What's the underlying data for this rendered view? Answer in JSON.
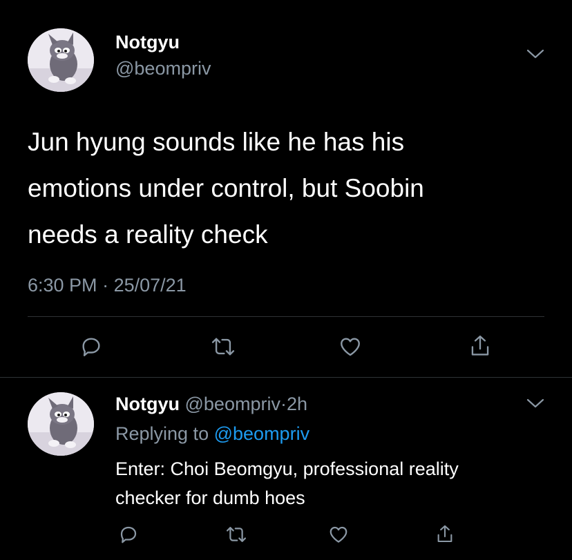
{
  "main_tweet": {
    "display_name": "Notgyu",
    "handle": "@beompriv",
    "text_lines": [
      "Jun hyung sounds like he has his",
      "emotions under control, but Soobin",
      "needs a reality check"
    ],
    "time": "6:30 PM",
    "separator": "·",
    "date": "25/07/21",
    "icons": [
      "reply-icon",
      "retweet-icon",
      "like-icon",
      "share-icon"
    ]
  },
  "reply_tweet": {
    "display_name": "Notgyu",
    "handle": "@beompriv",
    "separator": "·",
    "age": "2h",
    "replying_prefix": "Replying to",
    "replying_handle": "@beompriv",
    "text_lines": [
      "Enter: Choi Beomgyu, professional reality",
      "checker for dumb hoes"
    ],
    "icons": [
      "reply-icon",
      "retweet-icon",
      "like-icon",
      "share-icon"
    ]
  },
  "colors": {
    "background": "#000000",
    "text": "#ffffff",
    "muted": "#8b98a5",
    "link": "#1d9bf0",
    "divider": "#2f3336"
  }
}
